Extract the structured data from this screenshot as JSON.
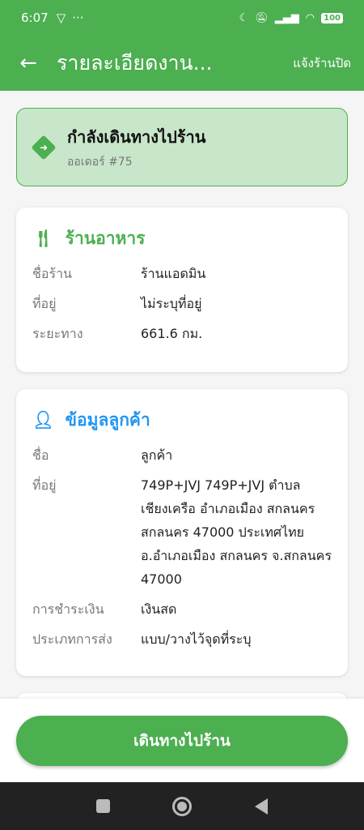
{
  "status_bar": {
    "time": "6:07",
    "dots": "···",
    "battery": "100"
  },
  "app_bar": {
    "title": "รายละเอียดงาน...",
    "action": "แจ้งร้านปิด"
  },
  "job_status": {
    "title": "กำลังเดินทางไปร้าน",
    "order": "ออเดอร์ #75"
  },
  "restaurant": {
    "heading": "ร้านอาหาร",
    "rows": [
      {
        "label": "ชื่อร้าน",
        "value": "ร้านแอดมิน"
      },
      {
        "label": "ที่อยู่",
        "value": "ไม่ระบุที่อยู่"
      },
      {
        "label": "ระยะทาง",
        "value": "661.6 กม."
      }
    ]
  },
  "customer": {
    "heading": "ข้อมูลลูกค้า",
    "rows": [
      {
        "label": "ชื่อ",
        "value": "ลูกค้า"
      },
      {
        "label": "ที่อยู่",
        "value": "749P+JVJ 749P+JVJ ตำบล เชียงเครือ อำเภอเมือง สกลนคร สกลนคร 47000 ประเทศไทย อ.อำเภอเมือง สกลนคร จ.สกลนคร 47000"
      },
      {
        "label": "การชำระเงิน",
        "value": "เงินสด"
      },
      {
        "label": "ประเภทการส่ง",
        "value": "แบบ/วางไว้จุดที่ระบุ"
      }
    ]
  },
  "primary_button": "เดินทางไปร้าน",
  "colors": {
    "primary": "#4caf50",
    "customer_accent": "#2196f3"
  }
}
